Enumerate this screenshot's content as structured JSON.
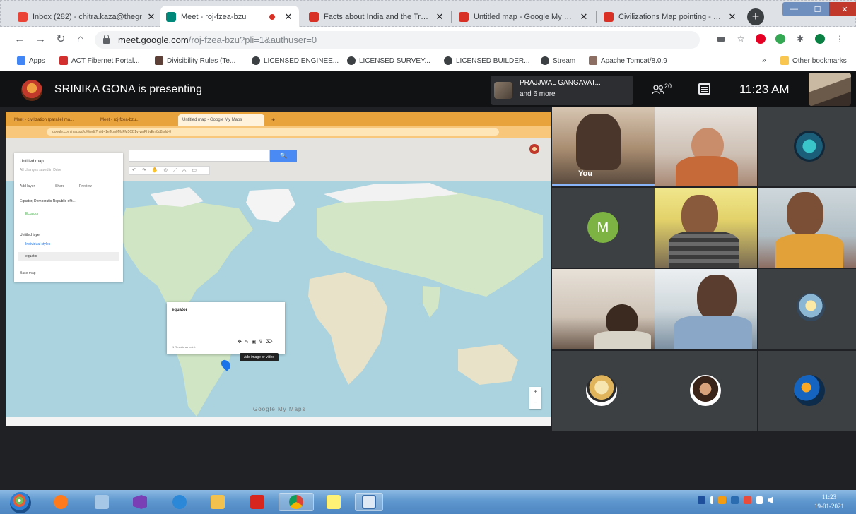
{
  "browser": {
    "tabs": [
      {
        "title": "Inbox (282) - chitra.kaza@thegr",
        "favicon_color": "#ea4335",
        "active": false
      },
      {
        "title": "Meet - roj-fzea-bzu",
        "favicon_color": "#00897b",
        "active": true
      },
      {
        "title": "Facts about India and the Tropi",
        "favicon_color": "#d93025",
        "active": false
      },
      {
        "title": "Untitled map - Google My Map",
        "favicon_color": "#d93025",
        "active": false
      },
      {
        "title": "Civilizations Map pointing - Go",
        "favicon_color": "#d93025",
        "active": false
      }
    ],
    "new_tab_label": "+",
    "window_controls": {
      "minimize": "—",
      "maximize": "☐",
      "close": "✕"
    },
    "address": {
      "host": "meet.google.com",
      "path": "/roj-fzea-bzu?pli=1&authuser=0"
    },
    "bookmarks": [
      {
        "label": "Apps",
        "icon": "apps-grid-icon",
        "color": "#4285f4"
      },
      {
        "label": "ACT Fibernet Portal...",
        "icon": "act-logo-icon",
        "color": "#d32f2f"
      },
      {
        "label": "Divisibility Rules (Te...",
        "icon": "site-icon",
        "color": "#5d4037"
      },
      {
        "label": "LICENSED ENGINEE...",
        "icon": "globe-icon",
        "color": "#3c4043"
      },
      {
        "label": "LICENSED SURVEY...",
        "icon": "globe-icon",
        "color": "#3c4043"
      },
      {
        "label": "LICENSED BUILDER...",
        "icon": "globe-icon",
        "color": "#3c4043"
      },
      {
        "label": "Stream",
        "icon": "globe-icon",
        "color": "#3c4043"
      },
      {
        "label": "Apache Tomcat/8.0.9",
        "icon": "tomcat-icon",
        "color": "#8d6e63"
      }
    ],
    "more_bookmarks": "»",
    "other_bookmarks": "Other bookmarks",
    "toolbar_icons": [
      "camera-icon",
      "star-icon",
      "pinterest-icon",
      "extension-green-icon",
      "puzzle-icon",
      "profile-icon",
      "menu-icon"
    ]
  },
  "meet": {
    "presenting_text": "SRINIKA GONA is presenting",
    "pinned": {
      "name": "PRAJJWAL GANGAVAT...",
      "sub": "and 6 more"
    },
    "participant_count": "20",
    "time": "11:23 AM",
    "you_label": "You",
    "letter_avatar": "M",
    "shared_screen": {
      "tabs": [
        "Meet - civilization (parallel ma...",
        "Meet - roj-fzea-bzu...",
        "Untitled map - Google My Maps",
        "+"
      ],
      "url": "google.com/maps/d/u/0/edit?mid=1eTcm0MxFM5CB1v-vmFhtyEm8d8sdd-0",
      "search_button": "🔍",
      "panel": {
        "title": "Untitled map",
        "subtitle": "All changes saved in Drive",
        "actions": [
          "Add layer",
          "Share",
          "Preview"
        ],
        "layer1": "Equator, Democratic Republic of t...",
        "layer1_item": "Ecuador",
        "layer2": "Untitled layer",
        "layer2_style": "Individual styles",
        "layer2_item": "equator",
        "base_map": "Base map"
      },
      "popup": {
        "title": "equator",
        "footer": "1 Results as point."
      },
      "tooltip": "Add image or video",
      "google_mark": "Google My Maps",
      "zoom": [
        "+",
        "−"
      ]
    }
  },
  "taskbar": {
    "apps": [
      {
        "name": "media-player-icon",
        "color": "#ff7a1a",
        "open": false
      },
      {
        "name": "notepad-icon",
        "color": "#a7c7e7",
        "open": false
      },
      {
        "name": "visual-studio-icon",
        "color": "#7b3fb5",
        "open": false
      },
      {
        "name": "internet-explorer-icon",
        "color": "#2b88d8",
        "open": false
      },
      {
        "name": "file-explorer-icon",
        "color": "#f2c14e",
        "open": false
      },
      {
        "name": "adobe-reader-icon",
        "color": "#d7261e",
        "open": false
      },
      {
        "name": "chrome-icon",
        "color": "#e94335",
        "open": true
      },
      {
        "name": "sticky-notes-icon",
        "color": "#fff176",
        "open": false
      },
      {
        "name": "onenote-icon",
        "color": "#dfe9f5",
        "open": true
      }
    ],
    "time": "11:23",
    "date": "19-01-2021"
  }
}
